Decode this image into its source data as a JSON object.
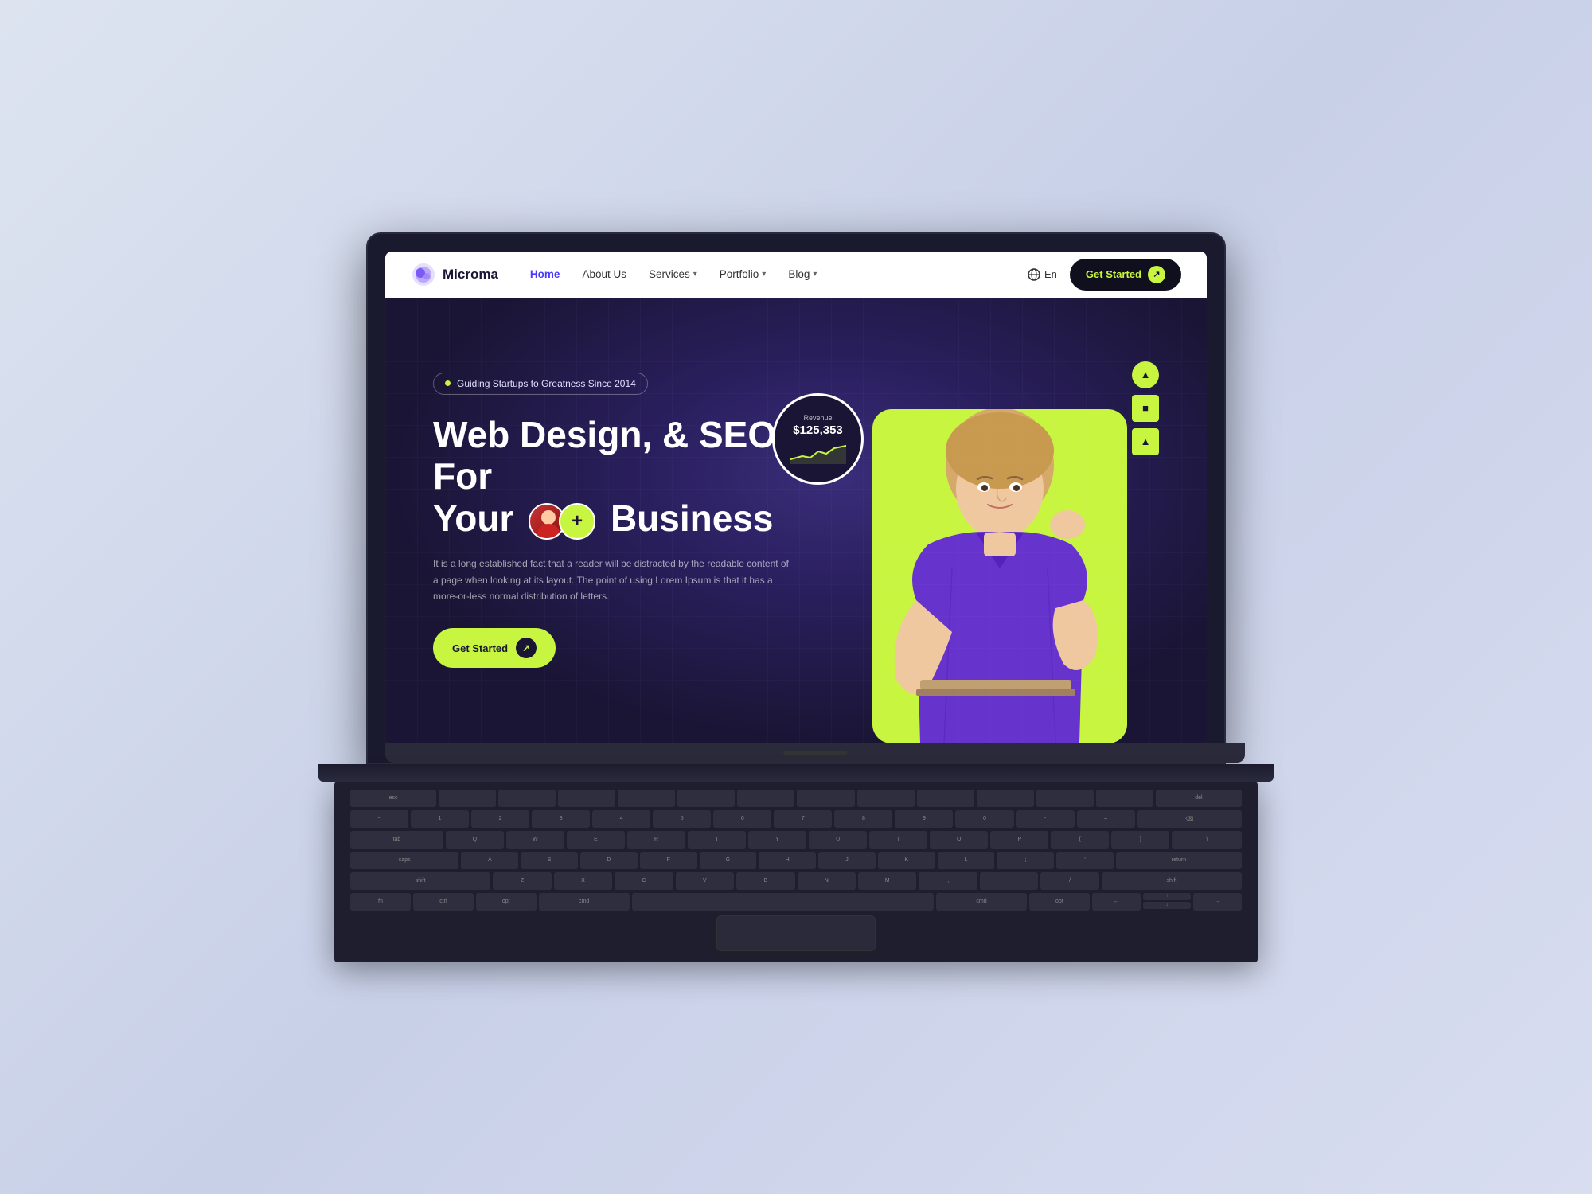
{
  "logo": {
    "name": "Microma",
    "icon_color": "#7b5bf5"
  },
  "navbar": {
    "links": [
      {
        "label": "Home",
        "active": true,
        "has_dropdown": false
      },
      {
        "label": "About Us",
        "active": false,
        "has_dropdown": false
      },
      {
        "label": "Services",
        "active": false,
        "has_dropdown": true
      },
      {
        "label": "Portfolio",
        "active": false,
        "has_dropdown": true
      },
      {
        "label": "Blog",
        "active": false,
        "has_dropdown": true
      }
    ],
    "lang": "En",
    "cta_label": "Get Started"
  },
  "hero": {
    "tagline": "Guiding Startups to Greatness Since 2014",
    "title_line1": "Web Design, & SEO For",
    "title_line2": "Your",
    "title_line3": "Business",
    "description": "It is a long established fact that a reader will be distracted by the readable content of a page when looking at its layout. The point of using Lorem Ipsum is that it has a more-or-less normal distribution of letters.",
    "cta_label": "Get Started",
    "revenue": {
      "label": "Revenue",
      "amount": "$125,353"
    }
  },
  "shapes": [
    {
      "type": "circle",
      "symbol": "▲"
    },
    {
      "type": "square",
      "symbol": "■"
    },
    {
      "type": "triangle",
      "symbol": "▲"
    }
  ],
  "keyboard": {
    "rows": [
      [
        "esc",
        "",
        "",
        "",
        "",
        "",
        "",
        "",
        "",
        "",
        "",
        "",
        "",
        "del"
      ],
      [
        "~",
        "1",
        "2",
        "3",
        "4",
        "5",
        "6",
        "7",
        "8",
        "9",
        "0",
        "-",
        "=",
        "⌫"
      ],
      [
        "tab",
        "q",
        "w",
        "e",
        "r",
        "t",
        "y",
        "u",
        "i",
        "o",
        "p",
        "[",
        "]",
        "\\"
      ],
      [
        "caps",
        "a",
        "s",
        "d",
        "f",
        "g",
        "h",
        "j",
        "k",
        "l",
        ";",
        "'",
        "return",
        ""
      ],
      [
        "shift",
        "z",
        "x",
        "c",
        "v",
        "b",
        "n",
        "m",
        ",",
        ".",
        "/",
        "shift",
        "",
        ""
      ],
      [
        "fn",
        "ctrl",
        "opt",
        "cmd",
        "",
        "",
        "",
        "cmd",
        "opt",
        "←",
        "↑",
        "↓",
        "→",
        ""
      ]
    ]
  },
  "colors": {
    "accent": "#c8f53f",
    "primary_bg": "#1a1535",
    "dark": "#0f0f1e",
    "navbar_bg": "#ffffff"
  }
}
